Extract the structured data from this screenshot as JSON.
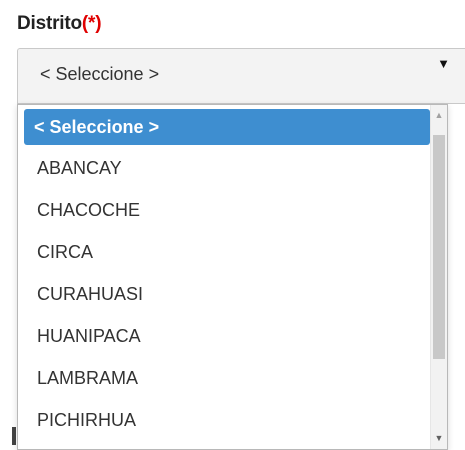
{
  "field": {
    "label": "Distrito",
    "required_marker": "(*)"
  },
  "select": {
    "value": "< Seleccione >",
    "caret": "▼"
  },
  "dropdown": {
    "options": [
      "< Seleccione >",
      "ABANCAY",
      "CHACOCHE",
      "CIRCA",
      "CURAHUASI",
      "HUANIPACA",
      "LAMBRAMA",
      "PICHIRHUA"
    ],
    "selected_index": 0
  },
  "scrollbar": {
    "up_arrow": "▲",
    "down_arrow": "▼"
  },
  "colors": {
    "selected_bg": "#3e8ed0",
    "required": "#e00000"
  }
}
